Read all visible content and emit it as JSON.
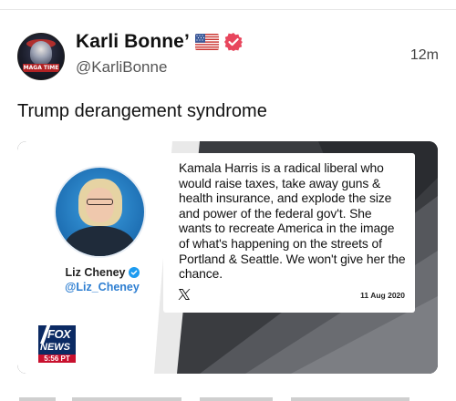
{
  "post": {
    "author": {
      "display_name": "Karli Bonne’",
      "handle": "@KarliBonne",
      "avatar_label": "MAGA TIME"
    },
    "timestamp": "12m",
    "text": "Trump derangement syndrome",
    "media": {
      "person_name": "Liz Cheney",
      "person_handle": "@Liz_Cheney",
      "quote_text": "Kamala Harris is a radical liberal who would raise taxes, take away guns & health insurance, and explode the size and power of the federal gov't. She wants to recreate America in the image of what's happening on the streets of Portland & Seattle. We won't give her the chance.",
      "quote_date": "11 Aug 2020",
      "network": {
        "line1": "FOX",
        "line2": "NEWS",
        "time": "5:56 PT"
      }
    }
  },
  "icons": {
    "flag": "us-flag-icon",
    "verified": "verified-badge-icon",
    "x_logo": "x-logo-icon"
  },
  "colors": {
    "verified_badge": "#e8465d",
    "quote_handle": "#2d7ed1",
    "fox_blue": "#0b2a63",
    "fox_red": "#c8102e"
  }
}
